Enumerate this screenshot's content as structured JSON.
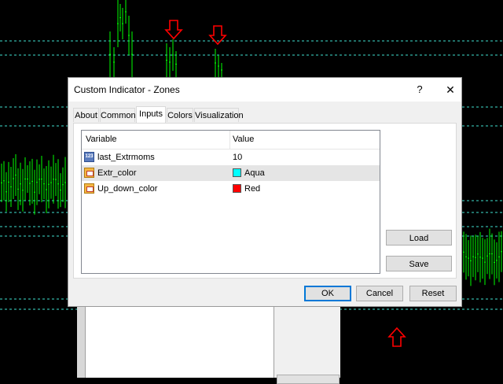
{
  "chart": {
    "background": "#000000",
    "candle_color": "#00ff00",
    "level_line_color": "#40e0d0",
    "arrow_color": "#ff0000",
    "arrow_icon": "arrow-down-icon / arrow-up-icon"
  },
  "dialog": {
    "title": "Custom Indicator - Zones",
    "help_label": "?",
    "close_label": "✕",
    "tabs": [
      {
        "label": "About"
      },
      {
        "label": "Common"
      },
      {
        "label": "Inputs"
      },
      {
        "label": "Colors"
      },
      {
        "label": "Visualization"
      }
    ],
    "active_tab": "Inputs",
    "grid": {
      "col_variable": "Variable",
      "col_value": "Value",
      "rows": [
        {
          "icon": "number-icon",
          "variable": "last_Extrmoms",
          "value": "10"
        },
        {
          "icon": "color-icon",
          "variable": "Extr_color",
          "value": "Aqua",
          "color": "#00ffff"
        },
        {
          "icon": "color-icon",
          "variable": "Up_down_color",
          "value": "Red",
          "color": "#ff0000"
        }
      ]
    },
    "load_label": "Load",
    "save_label": "Save",
    "ok_label": "OK",
    "cancel_label": "Cancel",
    "reset_label": "Reset"
  }
}
